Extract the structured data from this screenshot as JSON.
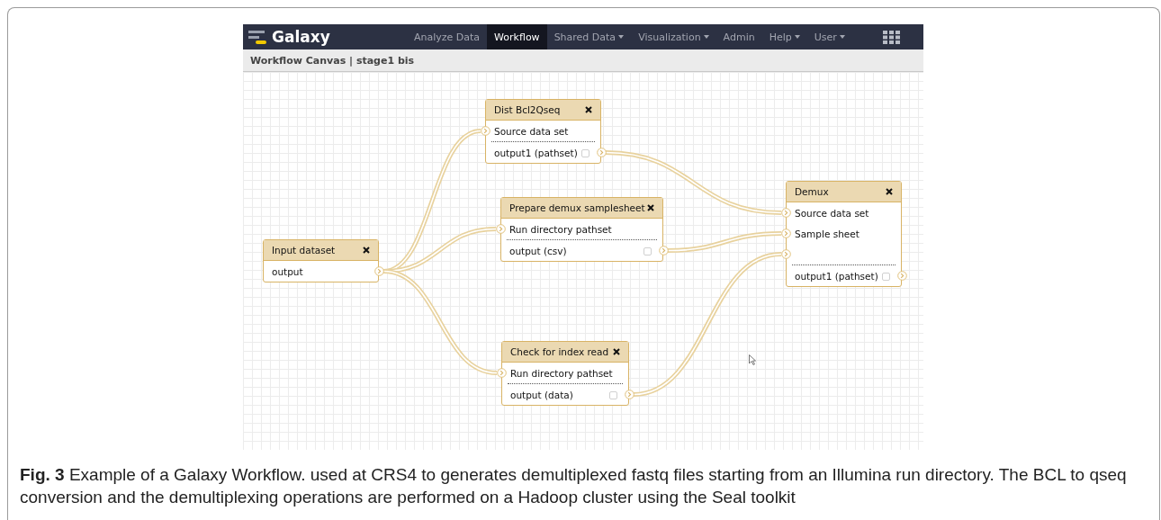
{
  "navbar": {
    "brand": "Galaxy",
    "items": [
      {
        "label": "Analyze Data",
        "selected": false,
        "has_menu": false
      },
      {
        "label": "Workflow",
        "selected": true,
        "has_menu": false
      },
      {
        "label": "Shared Data",
        "selected": false,
        "has_menu": true
      },
      {
        "label": "Visualization",
        "selected": false,
        "has_menu": true
      },
      {
        "label": "Admin",
        "selected": false,
        "has_menu": false
      },
      {
        "label": "Help",
        "selected": false,
        "has_menu": true
      },
      {
        "label": "User",
        "selected": false,
        "has_menu": true
      }
    ]
  },
  "title_bar": {
    "title": "Workflow Canvas | stage1 bis"
  },
  "canvas": {
    "nodes": [
      {
        "title": "Input dataset",
        "outputs": [
          {
            "label": "output",
            "connected": true
          }
        ]
      },
      {
        "title": "Dist Bcl2Qseq",
        "inputs": [
          {
            "kind": "labeled",
            "label": "Source data set",
            "connected": true
          }
        ],
        "outputs": [
          {
            "label": "output1 (pathset)",
            "checked": false,
            "connected": true
          }
        ]
      },
      {
        "title": "Prepare demux samplesheet",
        "inputs": [
          {
            "kind": "labeled",
            "label": "Run directory pathset",
            "connected": true
          }
        ],
        "outputs": [
          {
            "label": "output (csv)",
            "checked": false,
            "connected": true
          }
        ]
      },
      {
        "title": "Check for index read",
        "inputs": [
          {
            "kind": "labeled",
            "label": "Run directory pathset",
            "connected": true
          }
        ],
        "outputs": [
          {
            "label": "output (data)",
            "checked": false,
            "connected": true
          }
        ]
      },
      {
        "title": "Demux",
        "inputs": [
          {
            "kind": "labeled",
            "label": "Source data set",
            "connected": true
          },
          {
            "kind": "labeled",
            "label": "Sample sheet",
            "connected": true
          },
          {
            "kind": "unlabeled",
            "connected": true
          }
        ],
        "outputs": [
          {
            "label": "output1 (pathset)",
            "checked": false
          }
        ]
      }
    ]
  },
  "caption": "**Fig. 3** Example of a Galaxy Workflow. used at CRS4 to generates demultiplexed fastq files starting from an Illumina run directory. The BCL to qseq conversion and the demultiplexing operations are performed on a Hadoop cluster using the Seal toolkit"
}
